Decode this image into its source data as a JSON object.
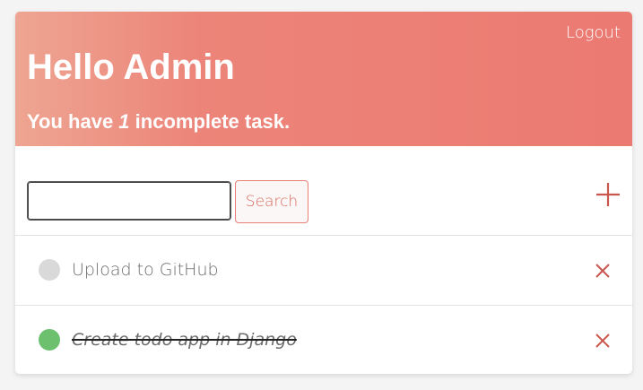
{
  "header": {
    "logout_label": "Logout",
    "greeting": "Hello Admin",
    "summary_prefix": "You have ",
    "incomplete_count": "1",
    "summary_suffix": " incomplete task."
  },
  "search": {
    "value": "",
    "placeholder": "",
    "button_label": "Search"
  },
  "add_icon": "plus-icon",
  "tasks": [
    {
      "title": "Upload to GitHub",
      "complete": false,
      "status_color": "#d9d9d9",
      "delete_icon": "close-icon"
    },
    {
      "title": "Create todo app in Django",
      "complete": true,
      "status_color": "#6cc06e",
      "delete_icon": "close-icon"
    }
  ],
  "colors": {
    "accent": "#eb7a72",
    "accent_light": "#eea592",
    "delete": "#c9574e",
    "complete": "#6cc06e",
    "incomplete": "#d9d9d9"
  }
}
